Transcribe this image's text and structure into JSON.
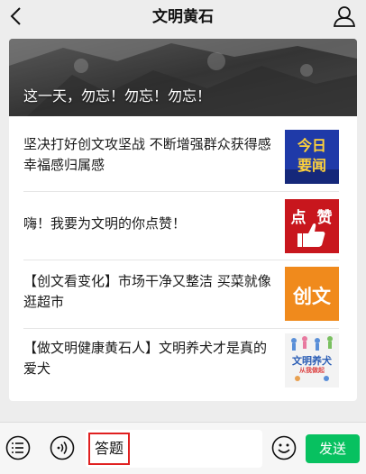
{
  "header": {
    "title": "文明黄石",
    "back_icon": "chevron-left-icon",
    "profile_icon": "person-icon"
  },
  "banner": {
    "title": "这一天，勿忘！勿忘！勿忘！"
  },
  "news": [
    {
      "text": "坚决打好创文攻坚战 不断增强群众获得感幸福感归属感",
      "thumb_lines": [
        "今日",
        "要闻"
      ]
    },
    {
      "text": "嗨！我要为文明的你点赞！",
      "thumb_lines": [
        "点",
        "赞"
      ]
    },
    {
      "text": "【创文看变化】市场干净又整洁 买菜就像逛超市",
      "thumb_lines": [
        "创文"
      ]
    },
    {
      "text": "【做文明健康黄石人】文明养犬才是真的爱犬",
      "thumb_lines": [
        "文明养犬",
        "从我做起"
      ]
    }
  ],
  "toolbar": {
    "menu_icon": "list-icon",
    "voice_icon": "voice-icon",
    "input_value": "答题",
    "emoji_icon": "emoji-icon",
    "send_label": "发送"
  },
  "colors": {
    "send_button": "#07c160",
    "highlight_border": "#e02020"
  }
}
